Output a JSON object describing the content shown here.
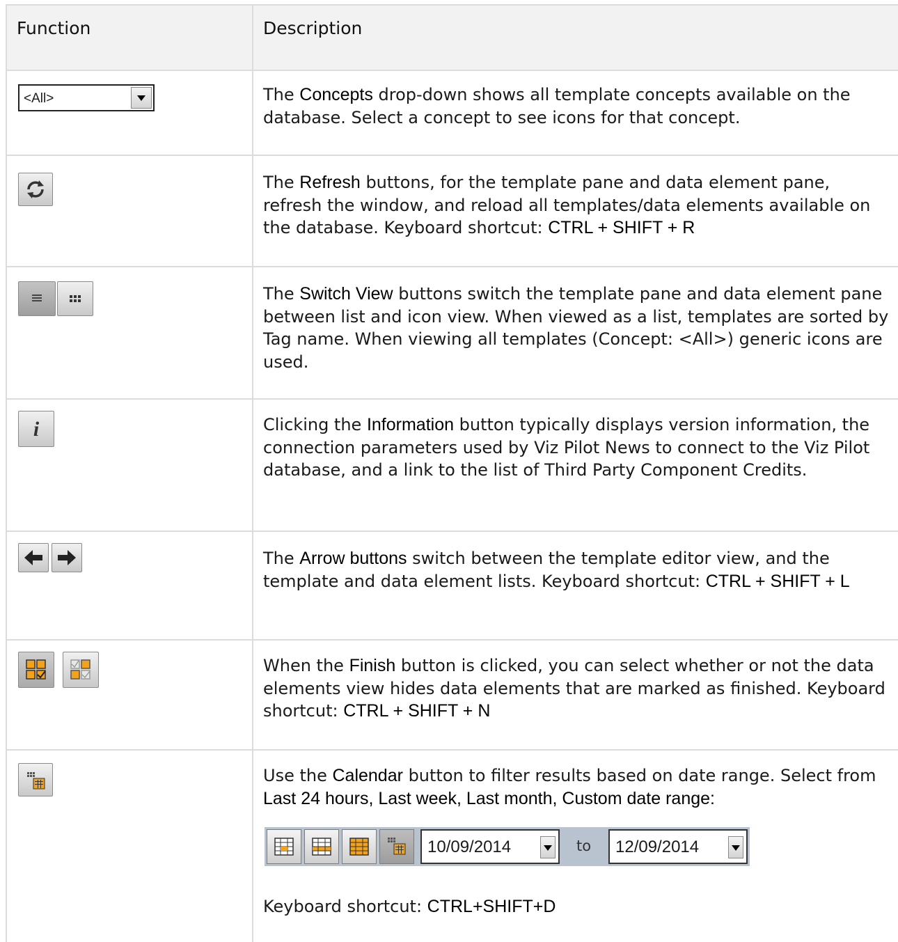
{
  "table": {
    "headers": [
      "Function",
      "Description"
    ],
    "rows": [
      {
        "function_icon": "concepts-dropdown-icon",
        "combo_value": "<All>",
        "description": [
          {
            "t": "The "
          },
          {
            "b": "Concepts"
          },
          {
            "t": " drop-down shows all template concepts available on the database. Select a concept to see icons for that concept."
          }
        ]
      },
      {
        "function_icon": "refresh-icon",
        "description": [
          {
            "t": "The "
          },
          {
            "b": "Refresh"
          },
          {
            "t": " buttons, for the template pane and data element pane, refresh the window, and reload all templates/data elements available on the database. Keyboard shortcut: "
          },
          {
            "b": "CTRL + SHIFT + R"
          }
        ]
      },
      {
        "function_icon": "switch-view-icons",
        "description": [
          {
            "t": "The "
          },
          {
            "b": "Switch View"
          },
          {
            "t": " buttons switch the template pane and data element pane between list and icon view. When viewed as a list, templates are sorted by Tag name. When viewing all templates (Concept: <All>) generic icons are used."
          }
        ]
      },
      {
        "function_icon": "information-icon",
        "description": [
          {
            "t": "Clicking the "
          },
          {
            "b": "Information"
          },
          {
            "t": " button typically displays version information, the connection parameters used by Viz Pilot News to connect to the Viz Pilot database, and a link to the list of Third Party Component Credits."
          }
        ]
      },
      {
        "function_icon": "arrow-icons",
        "description": [
          {
            "t": "The "
          },
          {
            "b": "Arrow buttons"
          },
          {
            "t": " switch between the template editor view, and the template and data element lists. Keyboard shortcut: "
          },
          {
            "b": "CTRL + SHIFT + L"
          }
        ]
      },
      {
        "function_icon": "finish-icons",
        "description": [
          {
            "t": "When the "
          },
          {
            "b": "Finish"
          },
          {
            "t": " button is clicked, you can select whether or not the data elements view hides data elements that are marked as finished. Keyboard shortcut: "
          },
          {
            "b": "CTRL + SHIFT + N"
          }
        ]
      },
      {
        "function_icon": "calendar-icon",
        "description": [
          {
            "t": "Use the "
          },
          {
            "b": "Calendar"
          },
          {
            "t": " button to filter results based on date range. Select from "
          },
          {
            "b": "Last 24 hours, Last week, Last month, Custom date range:"
          }
        ],
        "toolbar": {
          "from_date": "10/09/2014",
          "to_label": "to",
          "to_date": "12/09/2014"
        },
        "shortcut_prefix": "Keyboard shortcut: ",
        "shortcut": "CTRL+SHIFT+D"
      }
    ]
  },
  "colors": {
    "grid": "#dcdcdc",
    "header_bg": "#f2f2f2",
    "toolbar_bg": "#b9c3cf",
    "orange": "#f5a21b"
  }
}
